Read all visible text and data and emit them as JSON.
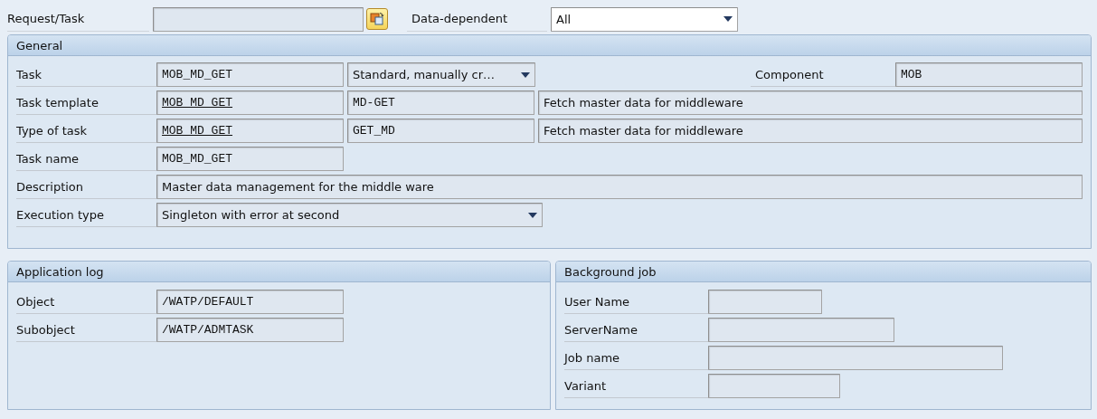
{
  "toolbar": {
    "request_label": "Request/Task",
    "request_field": {
      "kind": "blank"
    },
    "data_dependent_label": "Data-dependent",
    "data_dependent_field": {
      "kind": "dropdown",
      "value": "All",
      "editable": true
    }
  },
  "general": {
    "title": "General",
    "rows": [
      {
        "label": "Task",
        "fields": [
          {
            "kind": "code",
            "value": "MOB_MD_GET",
            "underlined": false
          },
          {
            "kind": "dropdown",
            "value": "Standard, manually cr…",
            "editable": false
          }
        ],
        "extra": {
          "label": "Component",
          "field": {
            "kind": "code",
            "value": "MOB",
            "underlined": false
          }
        }
      },
      {
        "label": "Task template",
        "fields": [
          {
            "kind": "code",
            "value": "MOB_MD_GET",
            "underlined": true
          },
          {
            "kind": "code",
            "value": "MD-GET",
            "underlined": false
          },
          {
            "kind": "text",
            "value": "Fetch master data for middleware"
          }
        ]
      },
      {
        "label": "Type of task",
        "fields": [
          {
            "kind": "code",
            "value": "MOB_MD_GET",
            "underlined": true
          },
          {
            "kind": "code",
            "value": "GET_MD",
            "underlined": false
          },
          {
            "kind": "text",
            "value": "Fetch master data for middleware"
          }
        ]
      },
      {
        "label": "Task name",
        "fields": [
          {
            "kind": "code",
            "value": "MOB_MD_GET",
            "underlined": false
          }
        ]
      },
      {
        "label": "Description",
        "fields": [
          {
            "kind": "text",
            "value": "Master data management for the middle ware"
          }
        ]
      },
      {
        "label": "Execution type",
        "fields": [
          {
            "kind": "dropdown",
            "value": "Singleton with error at second",
            "editable": false
          }
        ]
      }
    ]
  },
  "application_log": {
    "title": "Application log",
    "rows": [
      {
        "label": "Object",
        "fields": [
          {
            "kind": "code",
            "value": "/WATP/DEFAULT",
            "underlined": false
          }
        ]
      },
      {
        "label": "Subobject",
        "fields": [
          {
            "kind": "code",
            "value": "/WATP/ADMTASK",
            "underlined": false
          }
        ]
      }
    ]
  },
  "background_job": {
    "title": "Background job",
    "rows": [
      {
        "label": "User Name",
        "fields": [
          {
            "kind": "blank"
          }
        ]
      },
      {
        "label": "ServerName",
        "fields": [
          {
            "kind": "blank"
          }
        ]
      },
      {
        "label": "Job name",
        "fields": [
          {
            "kind": "blank"
          }
        ]
      },
      {
        "label": "Variant",
        "fields": [
          {
            "kind": "blank"
          }
        ]
      }
    ]
  }
}
